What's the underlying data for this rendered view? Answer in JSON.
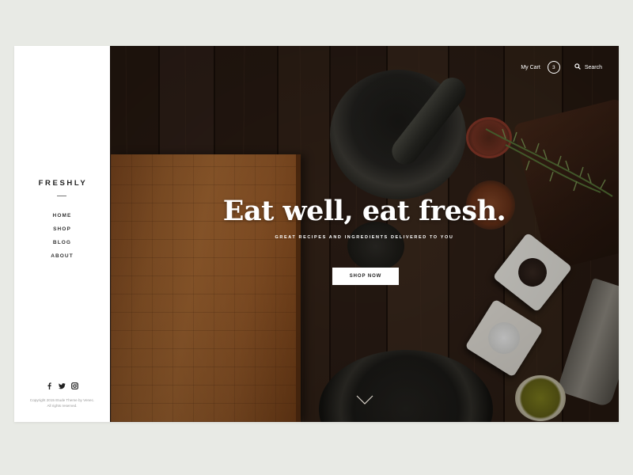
{
  "brand": {
    "name": "FRESHLY"
  },
  "nav": {
    "items": [
      {
        "label": "HOME"
      },
      {
        "label": "SHOP"
      },
      {
        "label": "BLOG"
      },
      {
        "label": "ABOUT"
      }
    ]
  },
  "social": {
    "icons": [
      "facebook-icon",
      "twitter-icon",
      "instagram-icon"
    ]
  },
  "footer": {
    "copyright_line1": "Copyright 2015 Etude Theme by Venec.",
    "copyright_line2": "All rights reserved."
  },
  "header": {
    "cart_label": "My Cart",
    "cart_count": "3",
    "search_label": "Search"
  },
  "hero": {
    "headline": "Eat well, eat fresh.",
    "subheadline": "GREAT RECIPES AND INGREDIENTS DELIVERED TO YOU",
    "cta_label": "SHOP NOW"
  },
  "colors": {
    "page_background": "#e8eae5",
    "sidebar_background": "#ffffff",
    "text_dark": "#222222",
    "hero_text": "#ffffff"
  }
}
